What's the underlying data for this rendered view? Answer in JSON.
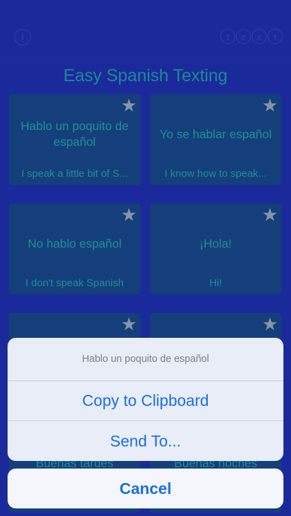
{
  "navbar": {
    "info_icon": "i",
    "text_logo_letters": [
      "t",
      "e",
      "x",
      "t"
    ]
  },
  "title": "Easy Spanish Texting",
  "cards": [
    {
      "es": "Hablo un poquito de español",
      "en": "I speak a little bit of S..."
    },
    {
      "es": "Yo se hablar español",
      "en": "I know how to speak..."
    },
    {
      "es": "No hablo español",
      "en": "I don't speak Spanish"
    },
    {
      "es": "¡Hola!",
      "en": "Hi!"
    },
    {
      "es": "Buenas tardes",
      "en": ""
    },
    {
      "es": "Buenas noches",
      "en": ""
    }
  ],
  "action_sheet": {
    "title": "Hablo un poquito de español",
    "copy_label": "Copy to Clipboard",
    "send_label": "Send To...",
    "cancel_label": "Cancel"
  },
  "icons": {
    "star": "star-icon",
    "info": "info-icon"
  },
  "colors": {
    "background": "#1a2a9a",
    "card": "#143f7a",
    "card_text": "#1f8f98",
    "action_blue": "#1a6ee6"
  }
}
